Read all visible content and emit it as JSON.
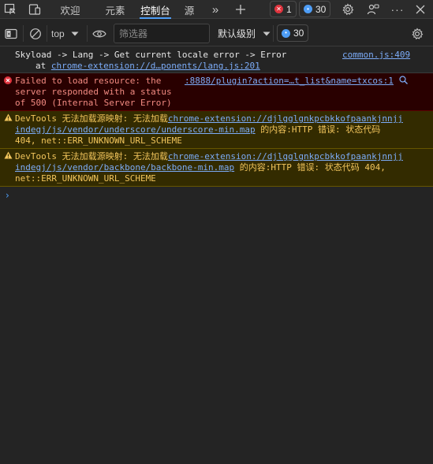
{
  "tabbar": {
    "tabs": [
      {
        "label": "欢迎"
      },
      {
        "label": "元素"
      },
      {
        "label": "控制台"
      },
      {
        "label": "源"
      }
    ],
    "error_count": "1",
    "message_count": "30"
  },
  "toolbar": {
    "context": "top",
    "filter_placeholder": "筛选器",
    "level": "默认级别",
    "issues_count": "30"
  },
  "console": {
    "log": {
      "line1": "Skyload -> Lang -> Get current locale error -> Error",
      "line2_prefix": "at ",
      "line2_link": "chrome-extension://d…ponents/lang.js:201",
      "source": "common.js:409"
    },
    "error": {
      "line1": "Failed to load resource: the",
      "line2": "server responded with a status",
      "line3": "of 500 (Internal Server Error)",
      "source": ":8888/plugin?action=…t_list&name=txcos:1"
    },
    "warnings": [
      {
        "prefix": "DevTools 无法加载源映射: 无法加载",
        "link1": "chrome-extension://djlgglgnkpcbkkofpaankjnnjj",
        "link2": "indegj/js/vendor/underscore/underscore-min.map",
        "suffix2": " 的内容:HTTP 错误: 状态代码",
        "line3": "404, net::ERR_UNKNOWN_URL_SCHEME"
      },
      {
        "prefix": "DevTools 无法加载源映射: 无法加载",
        "link1": "chrome-extension://djlgglgnkpcbkkofpaankjnnjj",
        "link2": "indegj/js/vendor/backbone/backbone-min.map",
        "suffix2": " 的内容:HTTP 错误: 状态代码 404,",
        "line3": "net::ERR_UNKNOWN_URL_SCHEME"
      }
    ],
    "prompt": "›"
  },
  "colors": {
    "accent": "#4e9df5",
    "error_bg": "#290000",
    "warn_bg": "#332b00",
    "error_text": "#f28b82",
    "warn_text": "#f2c55c",
    "link": "#7cacf8"
  },
  "icons": [
    "inspect-icon",
    "device-icon",
    "more-tabs-icon",
    "add-tab-icon",
    "settings-icon",
    "feedback-icon",
    "more-icon",
    "close-icon",
    "sidebar-icon",
    "clear-icon",
    "dropdown-icon",
    "eye-icon",
    "search-icon",
    "error-icon",
    "warning-icon"
  ]
}
